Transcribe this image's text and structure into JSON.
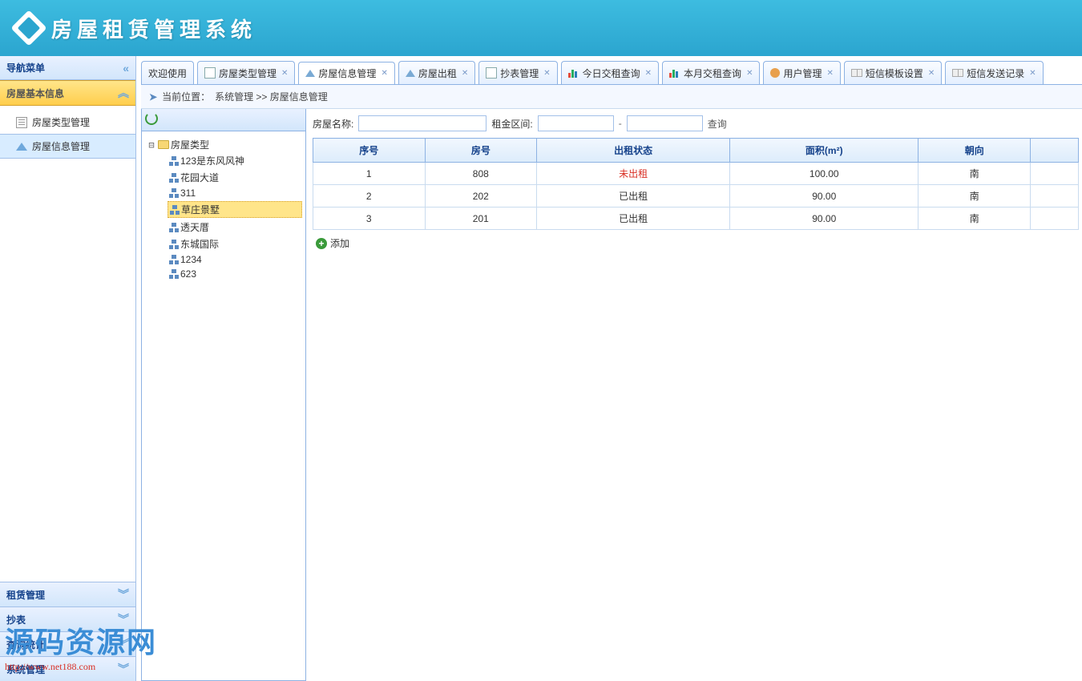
{
  "app": {
    "title": "房屋租赁管理系统"
  },
  "sidebar": {
    "header": "导航菜单",
    "groups": [
      {
        "title": "房屋基本信息",
        "expanded": true,
        "items": [
          {
            "label": "房屋类型管理",
            "icon": "doc"
          },
          {
            "label": "房屋信息管理",
            "icon": "house",
            "active": true
          }
        ]
      },
      {
        "title": "租赁管理",
        "expanded": false
      },
      {
        "title": "抄表",
        "expanded": false
      },
      {
        "title": "查询统计",
        "expanded": false
      },
      {
        "title": "系统管理",
        "expanded": false
      }
    ]
  },
  "tabs": [
    {
      "label": "欢迎使用",
      "icon": "none",
      "closable": false
    },
    {
      "label": "房屋类型管理",
      "icon": "page",
      "closable": true
    },
    {
      "label": "房屋信息管理",
      "icon": "home",
      "closable": true,
      "active": true
    },
    {
      "label": "房屋出租",
      "icon": "home",
      "closable": true
    },
    {
      "label": "抄表管理",
      "icon": "page",
      "closable": true
    },
    {
      "label": "今日交租查询",
      "icon": "chart",
      "closable": true
    },
    {
      "label": "本月交租查询",
      "icon": "chart",
      "closable": true
    },
    {
      "label": "用户管理",
      "icon": "user",
      "closable": true
    },
    {
      "label": "短信模板设置",
      "icon": "book",
      "closable": true
    },
    {
      "label": "短信发送记录",
      "icon": "book",
      "closable": true
    }
  ],
  "breadcrumb": {
    "prefix": "当前位置：",
    "path": "系统管理 >> 房屋信息管理"
  },
  "tree": {
    "root": "房屋类型",
    "children": [
      "123是东风风神",
      "花园大道",
      "311",
      "草庄景墅",
      "透天厝",
      "东城国际",
      "1234",
      "623"
    ],
    "selected": "草庄景墅"
  },
  "search": {
    "name_label": "房屋名称:",
    "rent_label": "租金区间:",
    "btn": "查询"
  },
  "table": {
    "columns": [
      "序号",
      "房号",
      "出租状态",
      "面积(m²)",
      "朝向",
      ""
    ],
    "rows": [
      {
        "cells": [
          "1",
          "808",
          "未出租",
          "100.00",
          "南",
          ""
        ],
        "status_red": true
      },
      {
        "cells": [
          "2",
          "202",
          "已出租",
          "90.00",
          "南",
          ""
        ],
        "status_red": false
      },
      {
        "cells": [
          "3",
          "201",
          "已出租",
          "90.00",
          "南",
          ""
        ],
        "status_red": false
      }
    ]
  },
  "add_label": "添加",
  "watermark": {
    "text": "源码资源网",
    "url": "http://www.net188.com"
  }
}
